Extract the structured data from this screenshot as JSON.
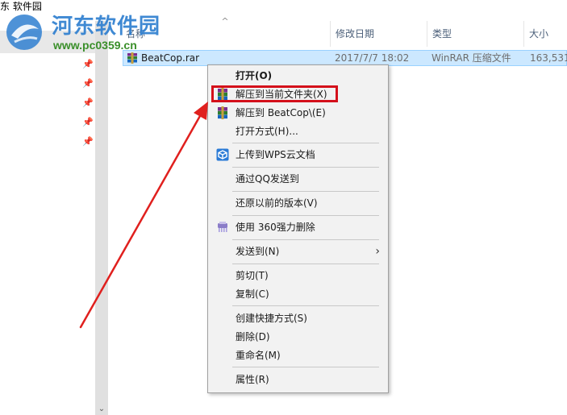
{
  "window": {
    "breadcrumb": "东 软件园"
  },
  "watermark": {
    "title": "河东软件园",
    "url": "www.pc0359.cn"
  },
  "columns": {
    "name": "名称",
    "date": "修改日期",
    "type": "类型",
    "size": "大小"
  },
  "file": {
    "name": "BeatCop.rar",
    "date": "2017/7/7 18:02",
    "type": "WinRAR 压缩文件",
    "size": "163,531"
  },
  "menu": {
    "open": "打开(O)",
    "extract_here": "解压到当前文件夹(X)",
    "extract_to": "解压到 BeatCop\\(E)",
    "open_with": "打开方式(H)...",
    "upload_wps": "上传到WPS云文档",
    "send_qq": "通过QQ发送到",
    "restore": "还原以前的版本(V)",
    "delete_360": "使用 360强力删除",
    "send_to": "发送到(N)",
    "cut": "剪切(T)",
    "copy": "复制(C)",
    "create_shortcut": "创建快捷方式(S)",
    "delete": "删除(D)",
    "rename": "重命名(M)",
    "properties": "属性(R)"
  },
  "colors": {
    "selection_bg": "#cce8ff",
    "highlight_red": "#d4101b",
    "watermark_blue": "#2f7fd0",
    "watermark_green": "#3a8f2a"
  }
}
